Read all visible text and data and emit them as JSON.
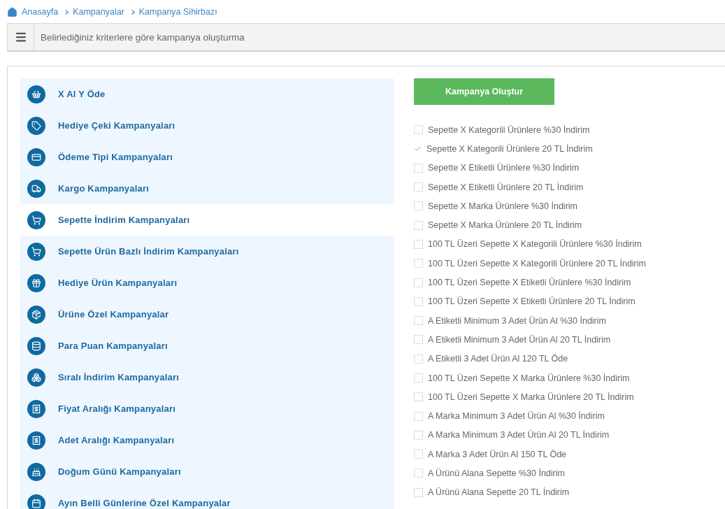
{
  "breadcrumb": [
    {
      "label": "Anasayfa"
    },
    {
      "label": "Kampanyalar"
    },
    {
      "label": "Kampanya Sihirbazı"
    }
  ],
  "header": {
    "title": "Belirlediğiniz kriterlere göre kampanya oluşturma"
  },
  "categories": [
    {
      "label": "X Al Y Öde",
      "selected": false
    },
    {
      "label": "Hediye Çeki Kampanyaları",
      "selected": false
    },
    {
      "label": "Ödeme Tipi Kampanyaları",
      "selected": false
    },
    {
      "label": "Kargo Kampanyaları",
      "selected": false
    },
    {
      "label": "Sepette İndirim Kampanyaları",
      "selected": true
    },
    {
      "label": "Sepette Ürün Bazlı İndirim Kampanyaları",
      "selected": false
    },
    {
      "label": "Hediye Ürün Kampanyaları",
      "selected": false
    },
    {
      "label": "Ürüne Özel Kampanyalar",
      "selected": false
    },
    {
      "label": "Para Puan Kampanyaları",
      "selected": false
    },
    {
      "label": "Sıralı İndirim Kampanyaları",
      "selected": false
    },
    {
      "label": "Fiyat Aralığı Kampanyaları",
      "selected": false
    },
    {
      "label": "Adet Aralığı Kampanyaları",
      "selected": false
    },
    {
      "label": "Doğum Günü Kampanyaları",
      "selected": false
    },
    {
      "label": "Ayın Belli Günlerine Özel Kampanyalar",
      "selected": false
    }
  ],
  "create_button": "Kampanya Oluştur",
  "options": [
    {
      "label": "Sepette X Kategorili Ürünlere %30 İndirim",
      "checked": false
    },
    {
      "label": "Sepette X Kategorili Ürünlere 20 TL İndirim",
      "checked": true
    },
    {
      "label": "Sepette X Etiketli Ürünlere %30 İndirim",
      "checked": false
    },
    {
      "label": "Sepette X Etiketli Ürünlere 20 TL İndirim",
      "checked": false
    },
    {
      "label": "Sepette X Marka Ürünlere %30 İndirim",
      "checked": false
    },
    {
      "label": "Sepette X Marka Ürünlere 20 TL İndirim",
      "checked": false
    },
    {
      "label": "100 TL Üzeri Sepette X Kategorili Ürünlere %30 İndirim",
      "checked": false
    },
    {
      "label": "100 TL Üzeri Sepette X Kategorili Ürünlere 20 TL İndirim",
      "checked": false
    },
    {
      "label": "100 TL Üzeri Sepette X Etiketli Ürünlere %30 İndirim",
      "checked": false
    },
    {
      "label": "100 TL Üzeri Sepette X Etiketli Ürünlere 20 TL İndirim",
      "checked": false
    },
    {
      "label": "A Etiketli Minimum 3 Adet Ürün Al %30 İndirim",
      "checked": false
    },
    {
      "label": "A Etiketli Minimum 3 Adet Ürün Al 20 TL İndirim",
      "checked": false
    },
    {
      "label": "A Etiketli 3 Adet Ürün Al 120 TL Öde",
      "checked": false
    },
    {
      "label": "100 TL Üzeri Sepette X Marka Ürünlere %30 İndirim",
      "checked": false
    },
    {
      "label": "100 TL Üzeri Sepette X Marka Ürünlere 20 TL İndirim",
      "checked": false
    },
    {
      "label": "A Marka Minimum 3 Adet Ürün Al %30 İndirim",
      "checked": false
    },
    {
      "label": "A Marka Minimum 3 Adet Ürün Al 20 TL İndirim",
      "checked": false
    },
    {
      "label": "A Marka 3 Adet Ürün Al 150 TL Öde",
      "checked": false
    },
    {
      "label": "A Ürünü Alana Sepette %30 İndirim",
      "checked": false
    },
    {
      "label": "A Ürünü Alana Sepette 20 TL İndirim",
      "checked": false
    }
  ]
}
